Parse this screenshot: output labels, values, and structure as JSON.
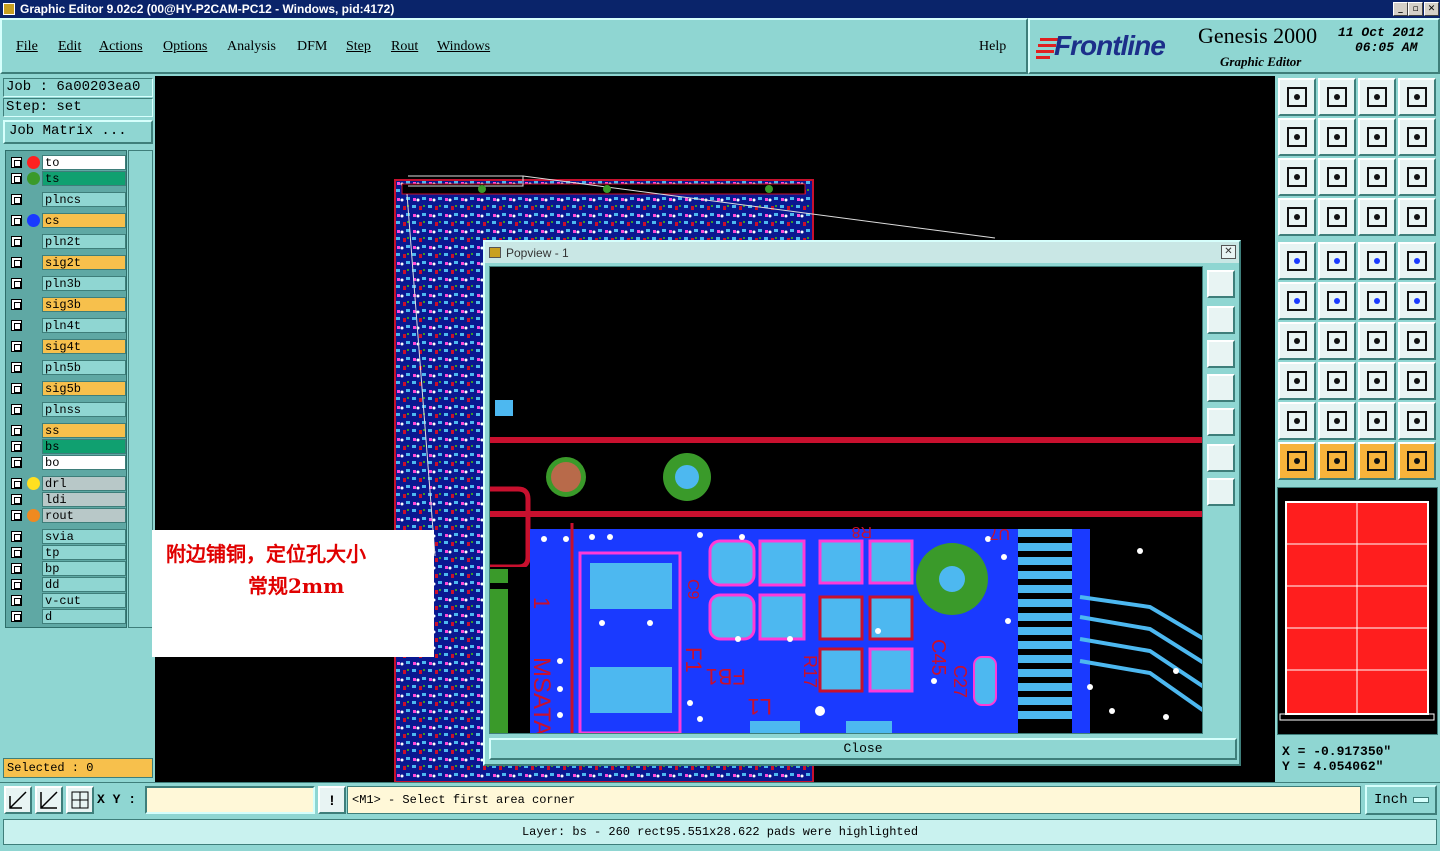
{
  "window": {
    "title": "Graphic Editor 9.02c2 (00@HY-P2CAM-PC12 - Windows, pid:4172)"
  },
  "menu": {
    "items": [
      {
        "label": "File"
      },
      {
        "label": "Edit"
      },
      {
        "label": "Actions"
      },
      {
        "label": "Options"
      },
      {
        "label": "Analysis"
      },
      {
        "label": "DFM"
      },
      {
        "label": "Step"
      },
      {
        "label": "Rout"
      },
      {
        "label": "Windows"
      }
    ],
    "help": "Help"
  },
  "logo": {
    "brand": "Frontline",
    "product": "Genesis 2000",
    "subtitle": "Graphic Editor",
    "date": "11 Oct 2012",
    "time": "06:05 AM",
    "brand_color": "#1c2f8a"
  },
  "job": {
    "job_text": "Job : 6a00203ea0",
    "step_text": "Step: set",
    "matrix_button": "Job Matrix ..."
  },
  "layers": [
    {
      "name": "to",
      "color": "#ffffff",
      "dot": "#ff2020",
      "sel": true
    },
    {
      "name": "ts",
      "color": "#10a070",
      "dot": "#3a9a2a"
    },
    {
      "name": "plncs",
      "color": "#8fd6d2"
    },
    {
      "name": "cs",
      "color": "#f7c04c",
      "dot": "#1a3aff"
    },
    {
      "name": "pln2t",
      "color": "#8fd6d2"
    },
    {
      "name": "sig2t",
      "color": "#f7c04c"
    },
    {
      "name": "pln3b",
      "color": "#8fd6d2"
    },
    {
      "name": "sig3b",
      "color": "#f7c04c"
    },
    {
      "name": "pln4t",
      "color": "#8fd6d2"
    },
    {
      "name": "sig4t",
      "color": "#f7c04c"
    },
    {
      "name": "pln5b",
      "color": "#8fd6d2"
    },
    {
      "name": "sig5b",
      "color": "#f7c04c"
    },
    {
      "name": "plnss",
      "color": "#8fd6d2"
    },
    {
      "name": "ss",
      "color": "#f7c04c"
    },
    {
      "name": "bs",
      "color": "#10a070"
    },
    {
      "name": "bo",
      "color": "#ffffff"
    },
    {
      "name": "drl",
      "color": "#b8c8c8",
      "dot": "#ffe020"
    },
    {
      "name": "ldi",
      "color": "#b8c8c8"
    },
    {
      "name": "rout",
      "color": "#b8c8c8",
      "dot": "#f08a20"
    },
    {
      "name": "svia",
      "color": "#8fd6d2"
    },
    {
      "name": "tp",
      "color": "#8fd6d2"
    },
    {
      "name": "bp",
      "color": "#8fd6d2"
    },
    {
      "name": "dd",
      "color": "#8fd6d2"
    },
    {
      "name": "v-cut",
      "color": "#8fd6d2"
    },
    {
      "name": "d",
      "color": "#8fd6d2"
    }
  ],
  "selected": "Selected : 0",
  "note": {
    "line1": "附边铺铜，定位孔大小",
    "line2": "常规2mm"
  },
  "popview": {
    "title": "Popview - 1",
    "close": "Close",
    "silkscreen": [
      "1",
      "MSATA1",
      "F1",
      "C9",
      "FB1",
      "R17",
      "C45",
      "C27",
      "L1",
      "R8",
      "U7"
    ]
  },
  "coords": {
    "x": "X = -0.917350\"",
    "y": "Y = 4.054062\""
  },
  "bottom": {
    "xy_label": "X Y :",
    "xy_value": "",
    "prompt": "<M1> - Select first area corner",
    "units": "Inch"
  },
  "status": "Layer: bs - 260 rect95.551x28.622 pads were highlighted",
  "colors": {
    "panel": "#8fd6d2",
    "copper_blue": "#1a3aff",
    "trace_red": "#c8102e",
    "pad_cyan": "#4db8f0",
    "solder_green": "#3a9a2a"
  }
}
